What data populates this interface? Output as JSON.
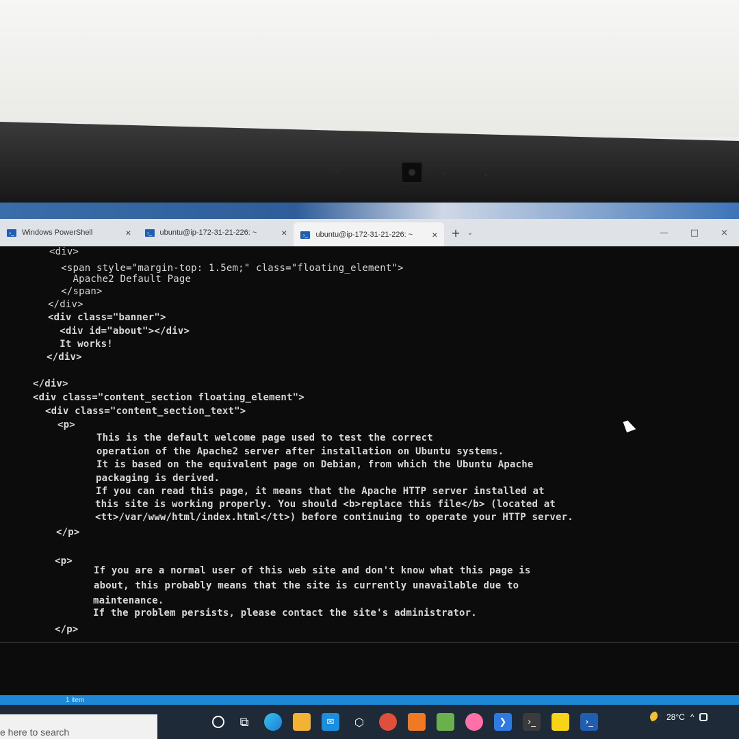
{
  "tabs": [
    {
      "label": "Windows PowerShell",
      "close": "×"
    },
    {
      "label": "ubuntu@ip-172-31-21-226: ~",
      "close": "×"
    },
    {
      "label": "ubuntu@ip-172-31-21-226: ~",
      "close": "×"
    }
  ],
  "tabbar": {
    "new_tab": "+",
    "dropdown": "⌄",
    "minimize": "—",
    "maximize": "□",
    "close": "×"
  },
  "terminal": {
    "lines": [
      "<div>",
      "  <span style=\"margin-top: 1.5em;\" class=\"floating_element\">",
      "    Apache2 Default Page",
      "  </span>",
      "</div>",
      "<div class=\"banner\">",
      "  <div id=\"about\"></div>",
      "  It works!",
      "</div>",
      "</div>",
      "<div class=\"content_section floating_element\">",
      "<div class=\"content_section_text\">",
      "<p>",
      "This is the default welcome page used to test the correct",
      "operation of the Apache2 server after installation on Ubuntu systems.",
      "It is based on the equivalent page on Debian, from which the Ubuntu Apache",
      "packaging is derived.",
      "If you can read this page, it means that the Apache HTTP server installed at",
      "this site is working properly. You should <b>replace this file</b> (located at",
      "<tt>/var/www/html/index.html</tt>) before continuing to operate your HTTP server.",
      "</p>",
      "<p>",
      "If you are a normal user of this web site and don't know what this page is",
      "about, this probably means that the site is currently unavailable due to",
      "maintenance.",
      "If the problem persists, please contact the site's administrator.",
      "</p>"
    ]
  },
  "widget_strip": {
    "label": "1 item"
  },
  "taskbar": {
    "search_placeholder": "e here to search",
    "temperature": "28°C",
    "tray_chevron": "^"
  },
  "colors": {
    "terminal_bg": "#0c0c0c",
    "terminal_fg": "#d8d8d8",
    "taskbar_bg": "#1e2a38",
    "accent": "#1f5fb3"
  }
}
